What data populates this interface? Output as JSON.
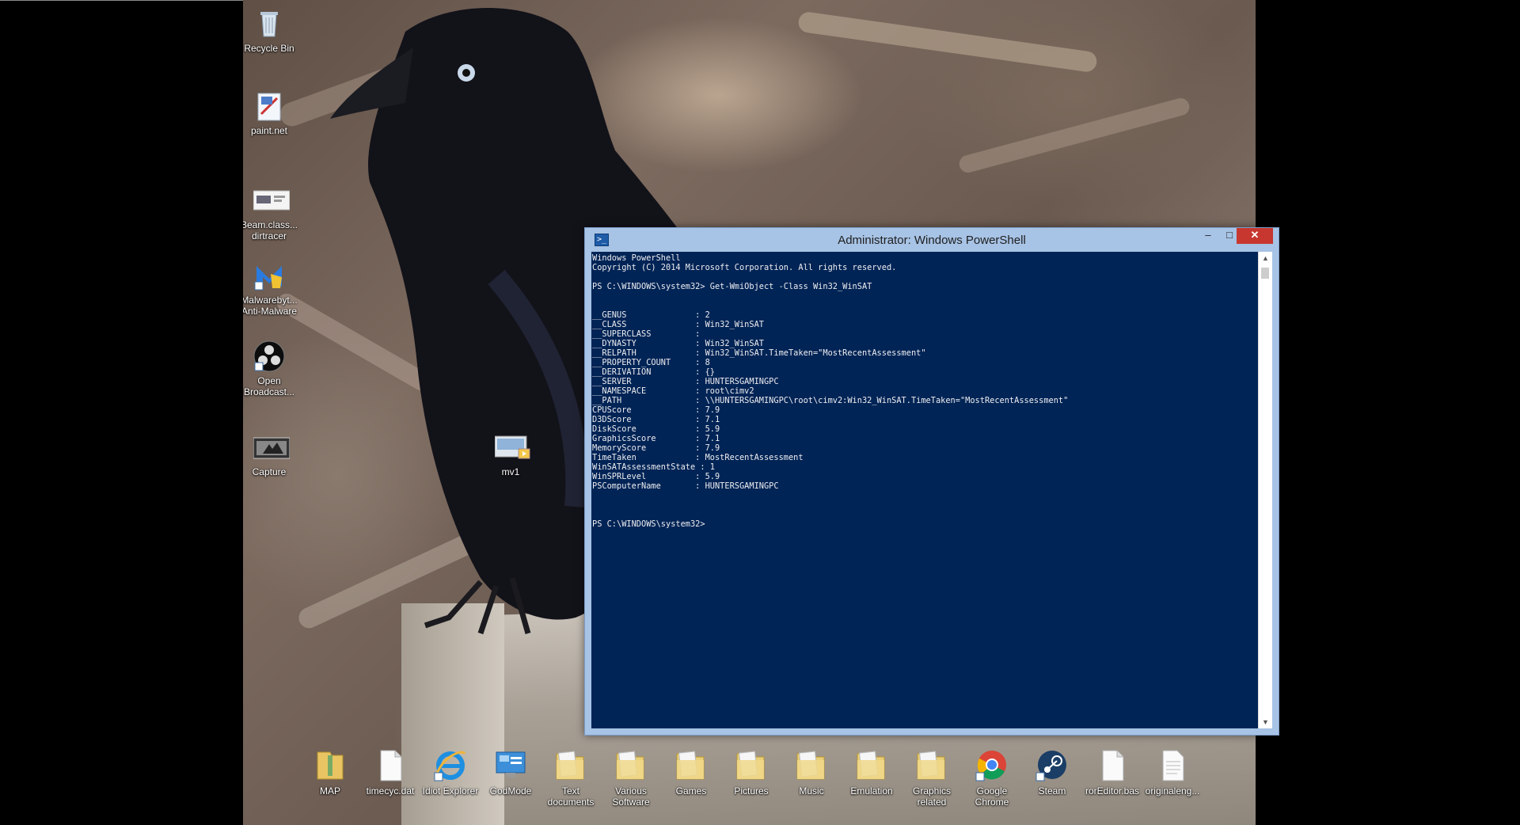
{
  "desktop_icons": [
    {
      "id": "recycle",
      "label": "Recycle Bin",
      "icon": "recycle-bin-icon"
    },
    {
      "id": "paint",
      "label": "paint.net",
      "icon": "paint-net-icon"
    },
    {
      "id": "beam",
      "label": "Beam.class...\ndirtracer",
      "icon": "document-thumbnail-icon"
    },
    {
      "id": "malware",
      "label": "Malwarebyt...\nAnti-Malware",
      "icon": "malwarebytes-icon"
    },
    {
      "id": "obs",
      "label": "Open\nBroadcast...",
      "icon": "obs-icon"
    },
    {
      "id": "capture",
      "label": "Capture",
      "icon": "image-thumbnail-icon"
    },
    {
      "id": "mv1",
      "label": "mv1",
      "icon": "video-file-icon"
    }
  ],
  "bottom_icons": [
    {
      "label": "MAP",
      "icon": "zip-folder-icon"
    },
    {
      "label": "timecyc.dat",
      "icon": "blank-file-icon"
    },
    {
      "label": "Idiot Explorer",
      "icon": "internet-explorer-icon"
    },
    {
      "label": "GodMode",
      "icon": "control-panel-icon"
    },
    {
      "label": "Text\ndocuments",
      "icon": "folder-icon"
    },
    {
      "label": "Various\nSoftware",
      "icon": "folder-icon"
    },
    {
      "label": "Games",
      "icon": "folder-icon"
    },
    {
      "label": "Pictures",
      "icon": "folder-icon"
    },
    {
      "label": "Music",
      "icon": "folder-icon"
    },
    {
      "label": "Emulation",
      "icon": "folder-icon"
    },
    {
      "label": "Graphics\nrelated",
      "icon": "folder-icon"
    },
    {
      "label": "Google\nChrome",
      "icon": "chrome-icon"
    },
    {
      "label": "Steam",
      "icon": "steam-icon"
    },
    {
      "label": "rorEditor.bas",
      "icon": "blank-file-icon"
    },
    {
      "label": "originaleng...",
      "icon": "text-file-icon"
    }
  ],
  "powershell": {
    "title": "Administrator: Windows PowerShell",
    "app_icon_glyph": ">_",
    "controls": {
      "minimize": "–",
      "maximize": "□",
      "close": "✕"
    },
    "console_text": "Windows PowerShell\nCopyright (C) 2014 Microsoft Corporation. All rights reserved.\n\nPS C:\\WINDOWS\\system32> Get-WmiObject -Class Win32_WinSAT\n\n\n__GENUS              : 2\n__CLASS              : Win32_WinSAT\n__SUPERCLASS         :\n__DYNASTY            : Win32_WinSAT\n__RELPATH            : Win32_WinSAT.TimeTaken=\"MostRecentAssessment\"\n__PROPERTY_COUNT     : 8\n__DERIVATION         : {}\n__SERVER             : HUNTERSGAMINGPC\n__NAMESPACE          : root\\cimv2\n__PATH               : \\\\HUNTERSGAMINGPC\\root\\cimv2:Win32_WinSAT.TimeTaken=\"MostRecentAssessment\"\nCPUScore             : 7.9\nD3DScore             : 7.1\nDiskScore            : 5.9\nGraphicsScore        : 7.1\nMemoryScore          : 7.9\nTimeTaken            : MostRecentAssessment\nWinSATAssessmentState : 1\nWinSPRLevel          : 5.9\nPSComputerName       : HUNTERSGAMINGPC\n\n\n\nPS C:\\WINDOWS\\system32>"
  }
}
